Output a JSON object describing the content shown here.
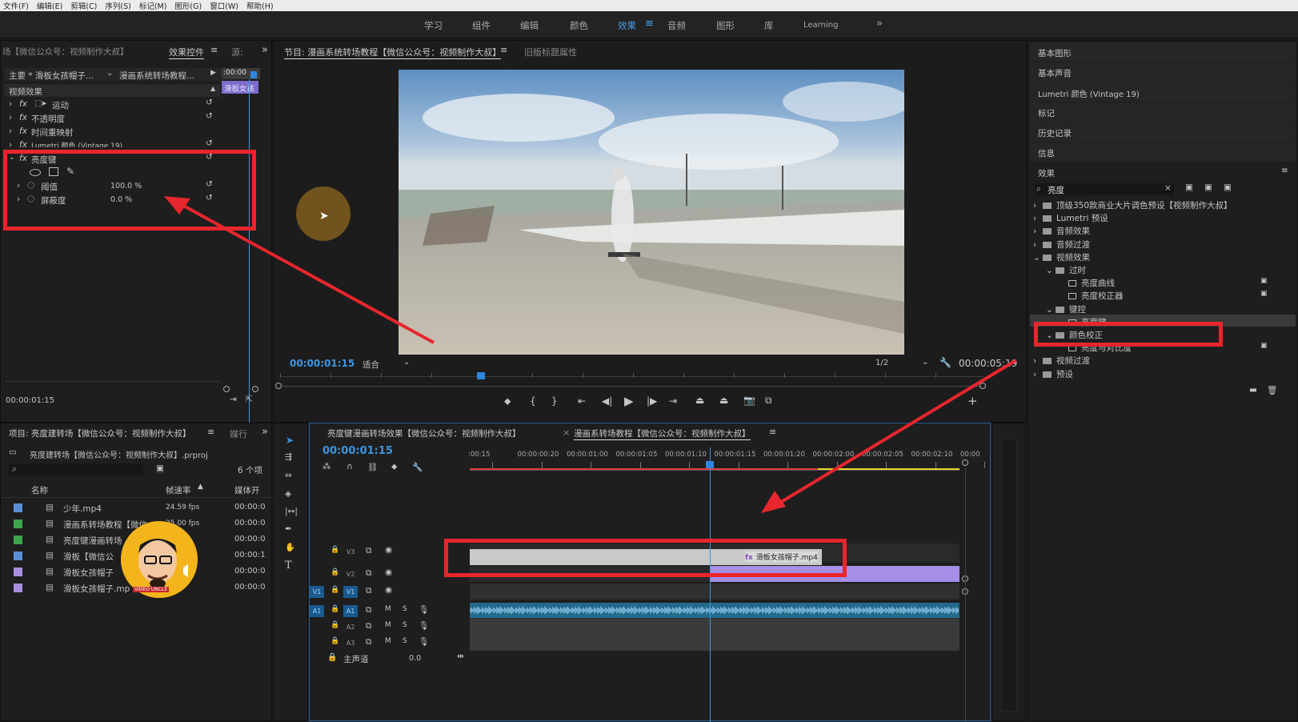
{
  "menu": [
    "文件(F)",
    "编辑(E)",
    "剪辑(C)",
    "序列(S)",
    "标记(M)",
    "图形(G)",
    "窗口(W)",
    "帮助(H)"
  ],
  "workspaces": [
    "学习",
    "组件",
    "编辑",
    "颜色",
    "效果",
    "音频",
    "图形",
    "库",
    "Learning"
  ],
  "active_workspace": "效果",
  "effect_controls": {
    "left_tab": "场【微信公众号：视频制作大叔】",
    "tab": "效果控件",
    "tab2": "源:",
    "source": "主要 * 滑板女孩帽子...",
    "sequence": "漫画系统转场教程...",
    "mini_time": ":00:00",
    "mini_clip": "滑板女孩",
    "section": "视频效果",
    "effects": [
      "运动",
      "不透明度",
      "时间重映射",
      "Lumetri 颜色 (Vintage 19)",
      "亮度键"
    ],
    "params": [
      {
        "name": "阈值",
        "value": "100.0 %"
      },
      {
        "name": "屏蔽度",
        "value": "0.0 %"
      }
    ],
    "timecode": "00:00:01:15"
  },
  "program": {
    "tab": "节目: 漫画系统转场教程【微信公众号：视频制作大叔】",
    "tab2": "旧版标题属性",
    "timecode": "00:00:01:15",
    "fit": "适合",
    "quality": "1/2",
    "duration": "00:00:05:19"
  },
  "project": {
    "tab": "项目: 亮度建转场【微信公众号：视频制作大叔】",
    "tab2": "媒行",
    "file": "亮度建转场【微信公众号：视频制作大叔】.prproj",
    "count": "6 个项",
    "columns": [
      "名称",
      "帧速率",
      "媒体开"
    ],
    "items": [
      {
        "name": "少年.mp4",
        "fps": "24.59 fps",
        "start": "00:00:0",
        "color": "#5b8ed6"
      },
      {
        "name": "漫画系转场教程【微信",
        "fps": "25.00 fps",
        "start": "00:00:0",
        "color": "#3fa34d"
      },
      {
        "name": "亮度键漫画转场",
        "fps": "",
        "start": "00:00:0",
        "color": "#3fa34d"
      },
      {
        "name": "滑板【微信公",
        "fps": "",
        "start": "00:00:1",
        "color": "#5b8ed6"
      },
      {
        "name": "滑板女孩帽子",
        "fps": "",
        "start": "00:00:0",
        "color": "#a890e0"
      },
      {
        "name": "滑板女孩帽子.mp",
        "fps": "",
        "start": "00:00:0",
        "color": "#a890e0"
      }
    ],
    "avatar_text": "VIDEO UNCLE"
  },
  "timeline": {
    "tab1": "亮度键漫画转场效果【微信公众号：视频制作大叔】",
    "tab2": "漫画系转场教程【微信公众号：视频制作大叔】",
    "timecode": "00:00:01:15",
    "ruler": [
      ":00:15",
      "00:00:00:20",
      "00:00:01:00",
      "00:00:01:05",
      "00:00:01:10",
      "00:00:01:15",
      "00:00:01:20",
      "00:00:02:00",
      "00:00:02:05",
      "00:00:02:10",
      "00:00"
    ],
    "tracks": [
      "V3",
      "V2",
      "V1",
      "A1",
      "A2",
      "A3"
    ],
    "clip_v3": "滑板女孩帽子.mp4",
    "master": "主声道",
    "master_val": "0.0",
    "msg": [
      "M",
      "S"
    ]
  },
  "right": {
    "panels": [
      "基本图形",
      "基本声音",
      "Lumetri 颜色 (Vintage 19)",
      "标记",
      "历史记录",
      "信息"
    ],
    "effects_title": "效果",
    "search": "亮度",
    "tree": [
      {
        "label": "顶级350款商业大片调色预设【视频制作大叔】",
        "level": 0,
        "type": "folder"
      },
      {
        "label": "Lumetri 预设",
        "level": 0,
        "type": "folder"
      },
      {
        "label": "音频效果",
        "level": 0,
        "type": "folder"
      },
      {
        "label": "音频过渡",
        "level": 0,
        "type": "folder"
      },
      {
        "label": "视频效果",
        "level": 0,
        "type": "folder"
      },
      {
        "label": "过时",
        "level": 1,
        "type": "folder"
      },
      {
        "label": "亮度曲线",
        "level": 2,
        "type": "fx"
      },
      {
        "label": "亮度校正器",
        "level": 2,
        "type": "fx"
      },
      {
        "label": "键控",
        "level": 1,
        "type": "folder"
      },
      {
        "label": "亮度键",
        "level": 2,
        "type": "fx"
      },
      {
        "label": "颜色校正",
        "level": 1,
        "type": "folder"
      },
      {
        "label": "亮度与对比度",
        "level": 2,
        "type": "fx"
      },
      {
        "label": "视频过渡",
        "level": 0,
        "type": "folder"
      },
      {
        "label": "预设",
        "level": 0,
        "type": "folder"
      }
    ]
  }
}
